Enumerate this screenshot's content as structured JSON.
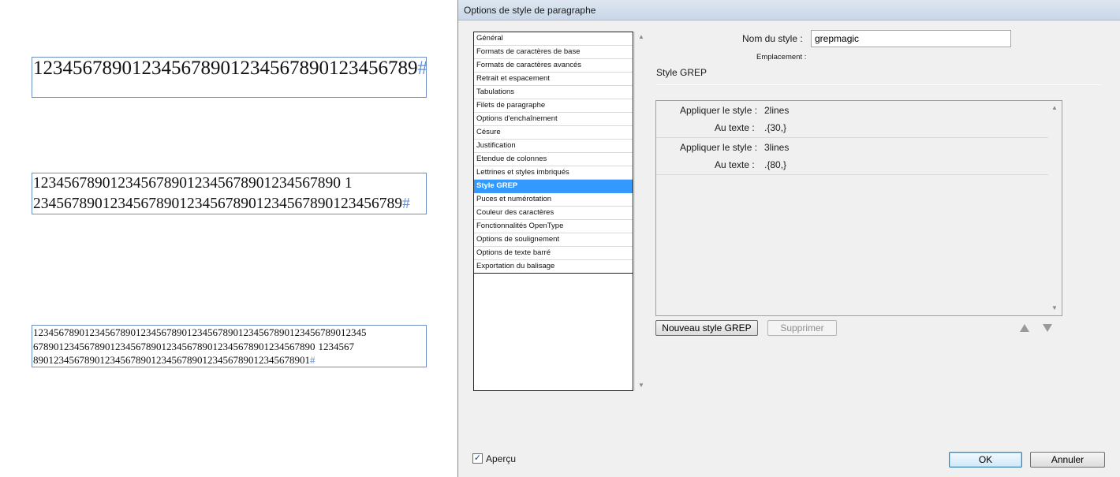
{
  "frames": {
    "frame1": {
      "lines": [
        "123456789012345678901234567890123456789"
      ],
      "end_marker": "#"
    },
    "frame2": {
      "lines": [
        "1234567890123456789012345678901234567890",
        "1234567890123456789012345678901234567890"
      ],
      "display_lines": [
        "1234567890123456789012345678901234567890 1",
        "234567890123456789012345678901234567890123456789"
      ],
      "end_marker": "#"
    },
    "frame3": {
      "line1": "12345678901234567890123456789012345678901234567890123456789012345",
      "line2a": "6789012345678901234567890123456789012345678901234567890",
      "line2b": "1234567",
      "line3": "890123456789012345678901234567890123456789012345678901",
      "end_marker": "#"
    }
  },
  "dialog": {
    "title": "Options de style de paragraphe",
    "categories": [
      "Général",
      "Formats de caractères de base",
      "Formats de caractères avancés",
      "Retrait et espacement",
      "Tabulations",
      "Filets de paragraphe",
      "Options d'enchaînement",
      "Césure",
      "Justification",
      "Etendue de colonnes",
      "Lettrines et styles imbriqués",
      "Style GREP",
      "Puces et numérotation",
      "Couleur des caractères",
      "Fonctionnalités OpenType",
      "Options de soulignement",
      "Options de texte barré",
      "Exportation du balisage"
    ],
    "selected_category": "Style GREP",
    "style_name_label": "Nom du style :",
    "style_name_value": "grepmagic",
    "location_label": "Emplacement :",
    "section_title": "Style GREP",
    "grep_rules": [
      {
        "apply_label": "Appliquer le style :",
        "apply_value": "2lines",
        "text_label": "Au texte :",
        "text_value": ".{30,}"
      },
      {
        "apply_label": "Appliquer le style :",
        "apply_value": "3lines",
        "text_label": "Au texte :",
        "text_value": ".{80,}"
      }
    ],
    "new_grep_button": "Nouveau style GREP",
    "delete_button": "Supprimer",
    "preview_label": "Aperçu",
    "preview_checked": true,
    "ok_button": "OK",
    "cancel_button": "Annuler"
  }
}
